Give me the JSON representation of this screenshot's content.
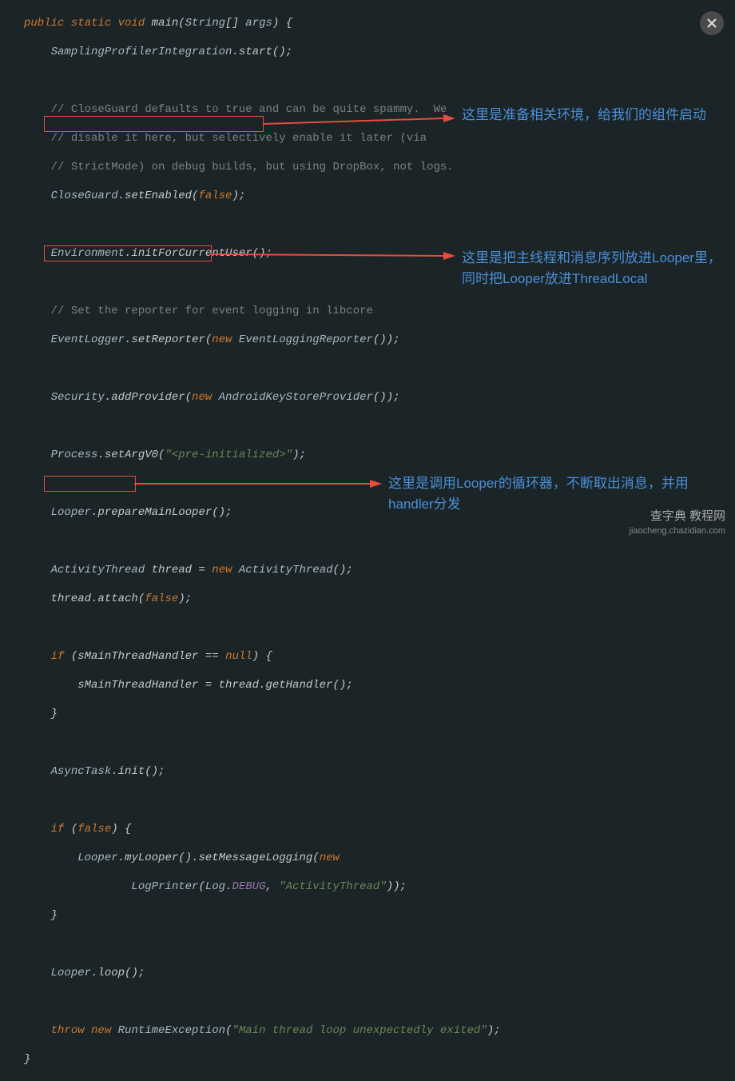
{
  "code": {
    "l1": "public static void main(String[] args) {",
    "l2": "    SamplingProfilerIntegration.start();",
    "l3": "",
    "l4": "    // CloseGuard defaults to true and can be quite spammy.  We",
    "l5": "    // disable it here, but selectively enable it later (via",
    "l6": "    // StrictMode) on debug builds, but using DropBox, not logs.",
    "l7": "    CloseGuard.setEnabled(false);",
    "l8": "",
    "l9": "    Environment.initForCurrentUser();",
    "l10": "",
    "l11": "    // Set the reporter for event logging in libcore",
    "l12": "    EventLogger.setReporter(new EventLoggingReporter());",
    "l13": "",
    "l14": "    Security.addProvider(new AndroidKeyStoreProvider());",
    "l15": "",
    "l16": "    Process.setArgV0(\"<pre-initialized>\");",
    "l17": "",
    "l18": "    Looper.prepareMainLooper();",
    "l19": "",
    "l20": "    ActivityThread thread = new ActivityThread();",
    "l21": "    thread.attach(false);",
    "l22": "",
    "l23": "    if (sMainThreadHandler == null) {",
    "l24": "        sMainThreadHandler = thread.getHandler();",
    "l25": "    }",
    "l26": "",
    "l27": "    AsyncTask.init();",
    "l28": "",
    "l29": "    if (false) {",
    "l30": "        Looper.myLooper().setMessageLogging(new",
    "l31": "                LogPrinter(Log.DEBUG, \"ActivityThread\"));",
    "l32": "    }",
    "l33": "",
    "l34": "    Looper.loop();",
    "l35": "",
    "l36": "    throw new RuntimeException(\"Main thread loop unexpectedly exited\");",
    "l37": "}"
  },
  "annotations": {
    "a1": "这里是准备相关环境，给我们的组件启动",
    "a2": "这里是把主线程和消息序列放进Looper里，同时把Looper放进ThreadLocal",
    "a3": "这里是调用Looper的循环器，不断取出消息，并用handler分发"
  },
  "watermark": {
    "brand": "查字典 教程网",
    "url": "jiaocheng.chazidian.com"
  },
  "close_label": "Close"
}
